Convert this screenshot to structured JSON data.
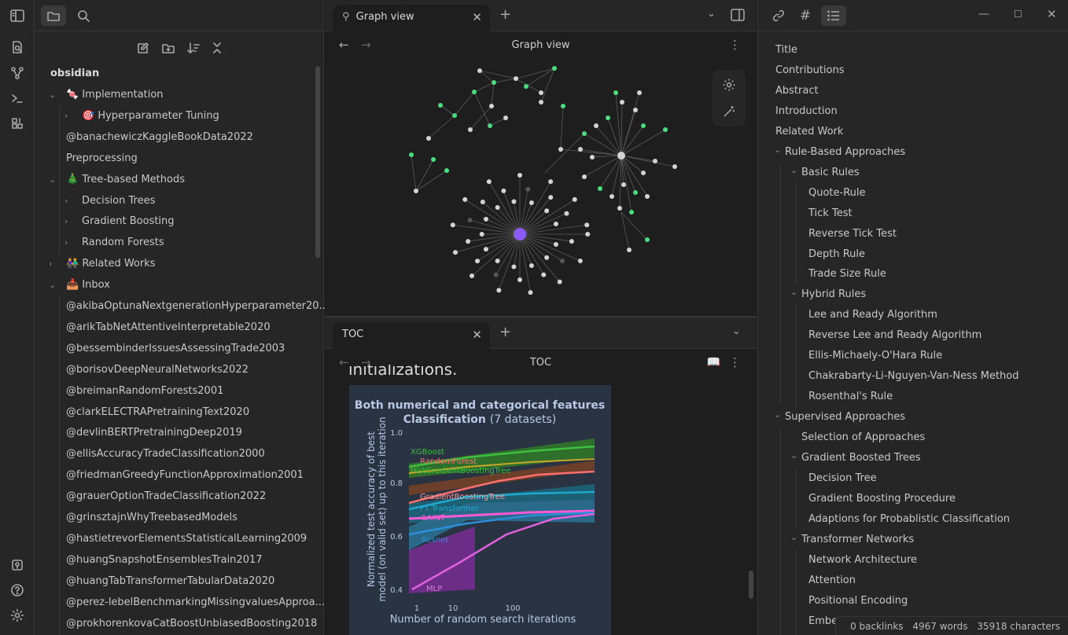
{
  "sidebar": {
    "vault_name": "obsidian",
    "items": [
      {
        "label": "🍬 Implementation",
        "chev": "⌄"
      },
      {
        "label": "🎯 Hyperparameter Tuning",
        "chev": "›"
      },
      {
        "label": "@banachewiczKaggleBookData2022",
        "chev": ""
      },
      {
        "label": "Preprocessing",
        "chev": ""
      },
      {
        "label": "🎄 Tree-based Methods",
        "chev": "⌄"
      },
      {
        "label": "Decision Trees",
        "chev": "›"
      },
      {
        "label": "Gradient Boosting",
        "chev": "›"
      },
      {
        "label": "Random Forests",
        "chev": "›"
      },
      {
        "label": "👫 Related Works",
        "chev": "›"
      },
      {
        "label": "📥 Inbox",
        "chev": "⌄"
      },
      {
        "label": "@akibaOptunaNextgenerationHyperparameter20...",
        "chev": ""
      },
      {
        "label": "@arikTabNetAttentiveInterpretable2020",
        "chev": ""
      },
      {
        "label": "@bessembinderIssuesAssessingTrade2003",
        "chev": ""
      },
      {
        "label": "@borisovDeepNeuralNetworks2022",
        "chev": ""
      },
      {
        "label": "@breimanRandomForests2001",
        "chev": ""
      },
      {
        "label": "@clarkELECTRAPretrainingText2020",
        "chev": ""
      },
      {
        "label": "@devlinBERTPretrainingDeep2019",
        "chev": ""
      },
      {
        "label": "@ellisAccuracyTradeClassification2000",
        "chev": ""
      },
      {
        "label": "@friedmanGreedyFunctionApproximation2001",
        "chev": ""
      },
      {
        "label": "@grauerOptionTradeClassification2022",
        "chev": ""
      },
      {
        "label": "@grinsztajnWhyTreebasedModels",
        "chev": ""
      },
      {
        "label": "@hastietrevorElementsStatisticalLearning2009",
        "chev": ""
      },
      {
        "label": "@huangSnapshotEnsemblesTrain2017",
        "chev": ""
      },
      {
        "label": "@huangTabTransformerTabularData2020",
        "chev": ""
      },
      {
        "label": "@perez-lebelBenchmarkingMissingvaluesApproa...",
        "chev": ""
      },
      {
        "label": "@prokhorenkovaCatBoostUnbiasedBoosting2018",
        "chev": ""
      }
    ]
  },
  "graph_pane": {
    "tab_label": "Graph view",
    "title": "Graph view"
  },
  "toc_pane": {
    "tab_label": "TOC",
    "title": "TOC",
    "cut_text": "initializations.",
    "figure": {
      "title_line1": "Both numerical and categorical features",
      "title_line2_bold": "Classification",
      "title_line2_rest": "(7 datasets)",
      "ylabel_line1": "Normalized test accuracy of best",
      "ylabel_line2": "model (on valid set) up to this iteration",
      "xlabel": "Number of random search iterations",
      "yticks": [
        "1.0",
        "0.8",
        "0.6",
        "0.4"
      ],
      "xticks": [
        "1",
        "10",
        "100"
      ],
      "series_labels": [
        "XGBoost",
        "RandomForest",
        "HistGradientBoostingTree",
        "GradientBoostingTree",
        "FT Transformer",
        "SAINT",
        "Resnet",
        "MLP"
      ]
    }
  },
  "outline": {
    "items": [
      {
        "label": "Title",
        "level": 0
      },
      {
        "label": "Contributions",
        "level": 0
      },
      {
        "label": "Abstract",
        "level": 0
      },
      {
        "label": "Introduction",
        "level": 0
      },
      {
        "label": "Related Work",
        "level": 0
      },
      {
        "label": "Rule-Based Approaches",
        "level": 1,
        "chev": true
      },
      {
        "label": "Basic Rules",
        "level": 2,
        "chev": true
      },
      {
        "label": "Quote-Rule",
        "level": 3
      },
      {
        "label": "Tick Test",
        "level": 3
      },
      {
        "label": "Reverse Tick Test",
        "level": 3
      },
      {
        "label": "Depth Rule",
        "level": 3
      },
      {
        "label": "Trade Size Rule",
        "level": 3
      },
      {
        "label": "Hybrid Rules",
        "level": 2,
        "chev": true
      },
      {
        "label": "Lee and Ready Algorithm",
        "level": 3
      },
      {
        "label": "Reverse Lee and Ready Algorithm",
        "level": 3
      },
      {
        "label": "Ellis-Michaely-O'Hara Rule",
        "level": 3
      },
      {
        "label": "Chakrabarty-Li-Nguyen-Van-Ness Method",
        "level": 3
      },
      {
        "label": "Rosenthal's Rule",
        "level": 3
      },
      {
        "label": "Supervised Approaches",
        "level": 1,
        "chev": true
      },
      {
        "label": "Selection of Approaches",
        "level": 2
      },
      {
        "label": "Gradient Boosted Trees",
        "level": 2,
        "chev": true
      },
      {
        "label": "Decision Tree",
        "level": 3
      },
      {
        "label": "Gradient Boosting Procedure",
        "level": 3
      },
      {
        "label": "Adaptions for Probablistic Classification",
        "level": 3
      },
      {
        "label": "Transformer Networks",
        "level": 2,
        "chev": true
      },
      {
        "label": "Network Architecture",
        "level": 3
      },
      {
        "label": "Attention",
        "level": 3
      },
      {
        "label": "Positional Encoding",
        "level": 3
      },
      {
        "label": "Embeddings",
        "level": 3
      }
    ]
  },
  "status": {
    "backlinks": "0 backlinks",
    "words": "4967 words",
    "chars": "35918 characters"
  },
  "colors": {
    "accent": "#8a5cf5",
    "node_green": "#4ade80",
    "node_grey": "#d4d4d4"
  }
}
